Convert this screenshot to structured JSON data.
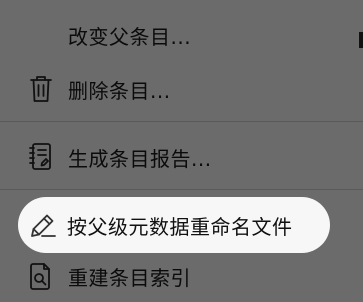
{
  "menu": {
    "items": [
      {
        "label": "改变父条目...",
        "icon": "none"
      },
      {
        "label": "删除条目...",
        "icon": "trash-icon"
      },
      {
        "label": "生成条目报告...",
        "icon": "report-icon"
      },
      {
        "label": "按父级元数据重命名文件",
        "icon": "pencil-icon"
      },
      {
        "label": "重建条目索引",
        "icon": "document-search-icon"
      }
    ]
  }
}
